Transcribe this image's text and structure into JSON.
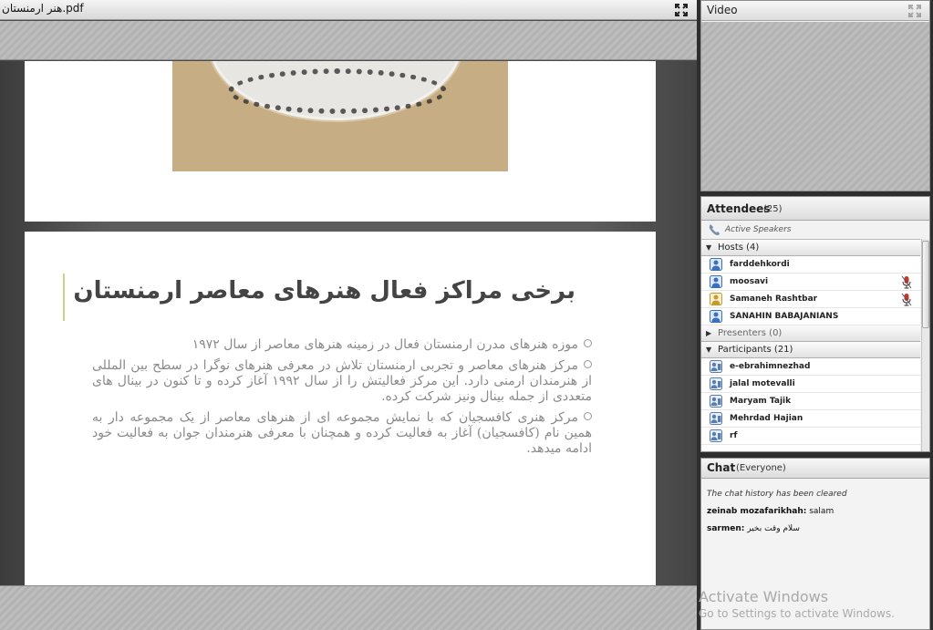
{
  "document": {
    "filename": "هنر ارمنستان.pdf",
    "slide": {
      "title": "برخی مراکز فعال هنرهای معاصر ارمنستان",
      "bullets": [
        "موزه هنرهای مدرن ارمنستان فعال در زمینه هنرهای معاصر از سال ۱۹۷۲",
        "مرکز هنرهای معاصر و تجربی ارمنستان تلاش در معرفی هنرهای نوگرا در سطح بین المللی از هنرمندان ارمنی دارد. این مرکز فعالیتش را از سال ۱۹۹۲ آغاز کرده و تا کنون در بینال های متعددی از جمله بینال ونیز شرکت کرده.",
        "مرکز هنری کافسجیان که با نمایش مجموعه ای از هنرهای معاصر از یک مجموعه دار به همین نام (کافسجیان) آغاز به فعالیت کرده و همچنان با معرفی هنرمندان جوان به فعالیت خود ادامه میدهد."
      ]
    }
  },
  "video": {
    "title": "Video"
  },
  "attendees": {
    "title": "Attendees",
    "count": "(25)",
    "active_speakers": "Active Speakers",
    "hosts": {
      "label": "Hosts (4)",
      "members": [
        {
          "name": "farddehkordi",
          "mic": false
        },
        {
          "name": "moosavi",
          "mic": true
        },
        {
          "name": "Samaneh Rashtbar",
          "mic": true
        },
        {
          "name": "SANAHIN BABAJANIANS",
          "mic": false
        }
      ]
    },
    "presenters": {
      "label": "Presenters (0)"
    },
    "participants": {
      "label": "Participants (21)",
      "members": [
        "e-ebrahimnezhad",
        "jalal motevalli",
        "Maryam Tajik",
        "Mehrdad Hajian",
        "rf"
      ]
    }
  },
  "chat": {
    "title": "Chat",
    "scope": "(Everyone)",
    "system_message": "The chat history has been cleared",
    "messages": [
      {
        "user": "zeinab mozafarikhah:",
        "text": "salam"
      },
      {
        "user": "sarmen:",
        "text": "سلام وقت بخیر"
      }
    ]
  },
  "watermark": {
    "line1": "Activate Windows",
    "line2": "Go to Settings to activate Windows."
  },
  "colors": {
    "slide_accent": "#c9d38a",
    "host_icon": "#3b6fbf",
    "mic_icon": "#c0392b"
  }
}
